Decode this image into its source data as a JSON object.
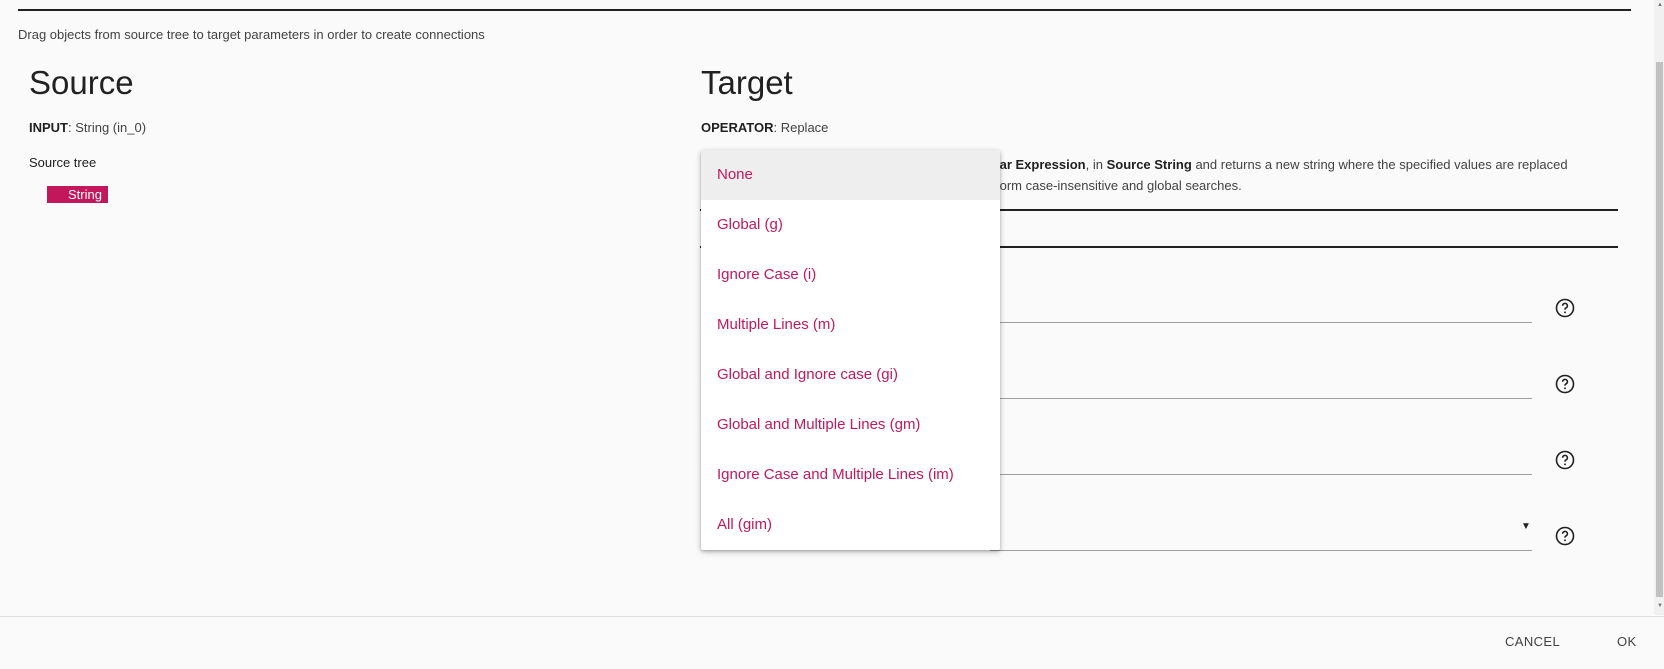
{
  "instructions": "Drag objects from source tree to target parameters in order to create connections",
  "source": {
    "title": "Source",
    "input_label": "INPUT",
    "input_value": ": String (in_0)",
    "tree_label": "Source tree",
    "tree_node": "String"
  },
  "target": {
    "title": "Target",
    "operator_label": "OPERATOR",
    "operator_value": ": Replace",
    "description": {
      "part1": "lar Expression",
      "part2": ", in ",
      "part3": "Source String",
      "part4": " and returns a new string where the specified values are replaced",
      "line2": "form case-insensitive and global searches."
    }
  },
  "dropdown": {
    "selected": "None",
    "options": [
      "None",
      "Global (g)",
      "Ignore Case (i)",
      "Multiple Lines (m)",
      "Global and Ignore case (gi)",
      "Global and Multiple Lines (gm)",
      "Ignore Case and Multiple Lines (im)",
      "All (gim)"
    ]
  },
  "icons": {
    "help": "help-circle-icon",
    "caret": "caret-down-icon"
  },
  "footer": {
    "cancel_label": "CANCEL",
    "ok_label": "OK"
  },
  "colors": {
    "accent": "#c2185b",
    "text": "#212121",
    "background": "#fafafa"
  }
}
